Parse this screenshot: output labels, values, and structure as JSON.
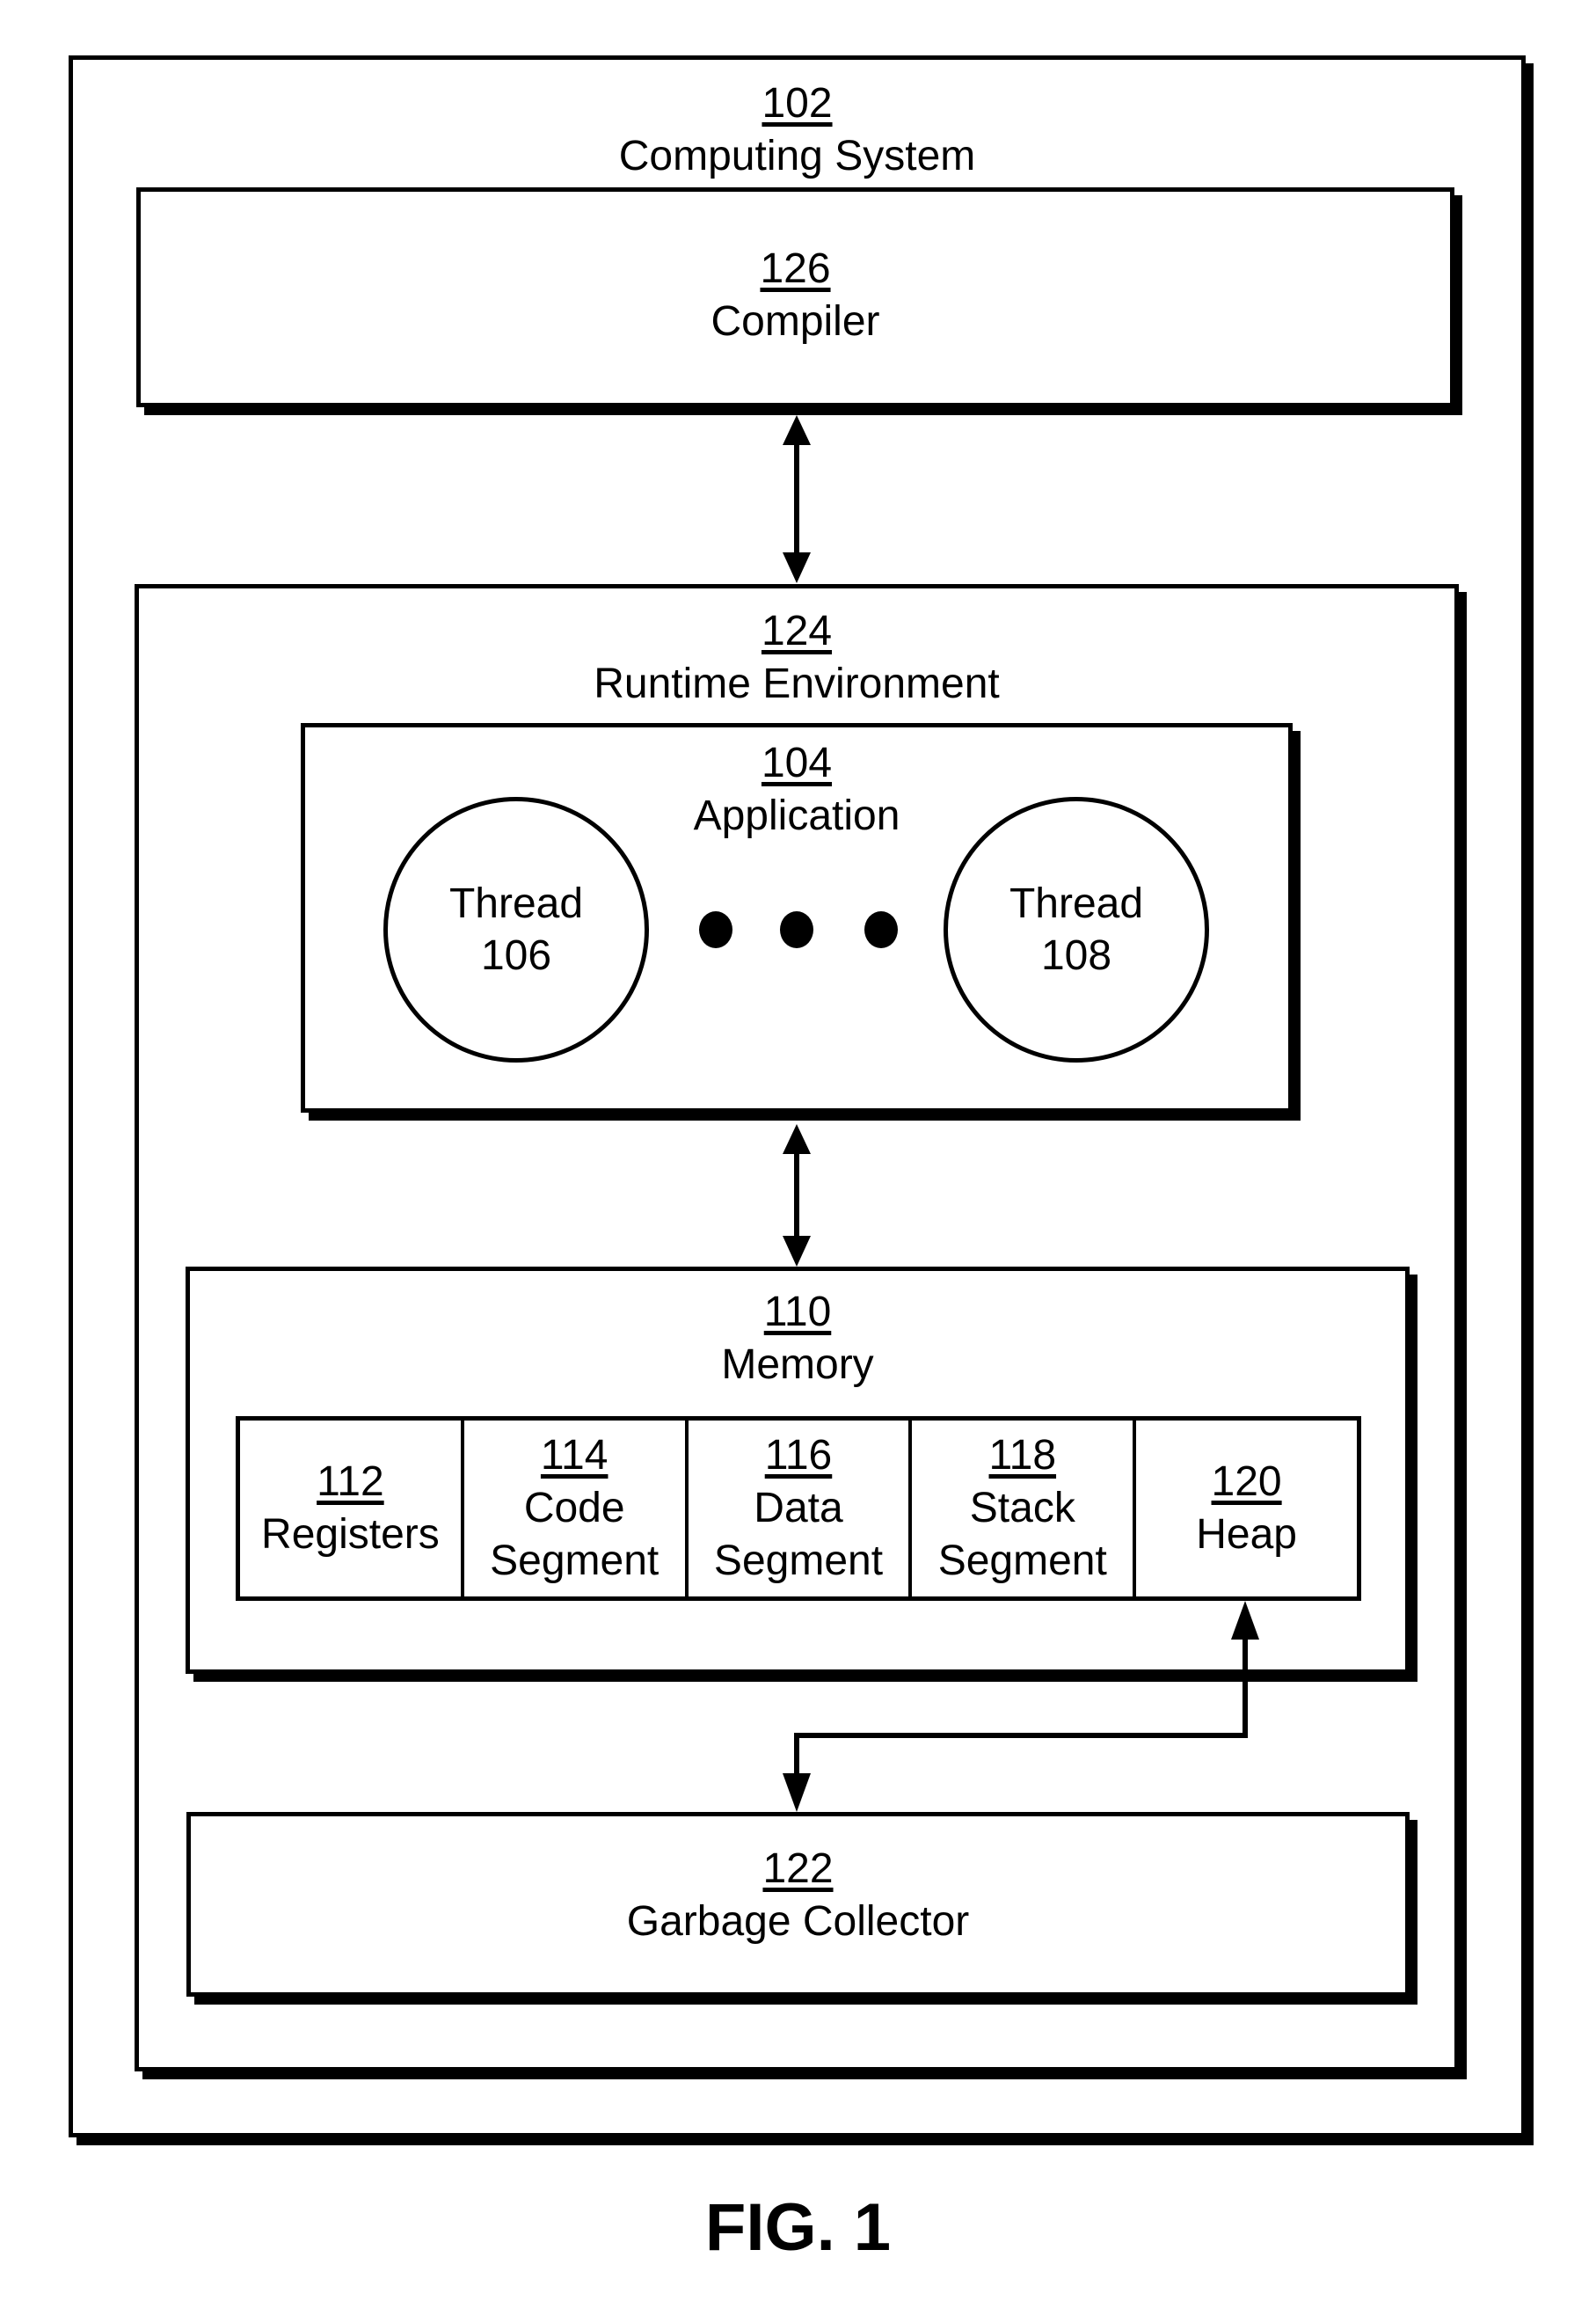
{
  "figure_label": "FIG. 1",
  "computing_system": {
    "number": "102",
    "label": "Computing System"
  },
  "compiler": {
    "number": "126",
    "label": "Compiler"
  },
  "runtime_environment": {
    "number": "124",
    "label": "Runtime Environment"
  },
  "application": {
    "number": "104",
    "label": "Application",
    "threads": [
      {
        "label": "Thread",
        "number": "106"
      },
      {
        "label": "Thread",
        "number": "108"
      }
    ],
    "ellipsis": "..."
  },
  "memory": {
    "number": "110",
    "label": "Memory",
    "segments": [
      {
        "number": "112",
        "lines": [
          "Registers"
        ]
      },
      {
        "number": "114",
        "lines": [
          "Code",
          "Segment"
        ]
      },
      {
        "number": "116",
        "lines": [
          "Data",
          "Segment"
        ]
      },
      {
        "number": "118",
        "lines": [
          "Stack",
          "Segment"
        ]
      },
      {
        "number": "120",
        "lines": [
          "Heap"
        ]
      }
    ]
  },
  "garbage_collector": {
    "number": "122",
    "label": "Garbage Collector"
  },
  "connections": [
    {
      "from": "compiler",
      "to": "runtime_environment",
      "direction": "bidirectional"
    },
    {
      "from": "application",
      "to": "memory",
      "direction": "bidirectional"
    },
    {
      "from": "heap",
      "to": "garbage_collector",
      "direction": "bidirectional"
    }
  ]
}
